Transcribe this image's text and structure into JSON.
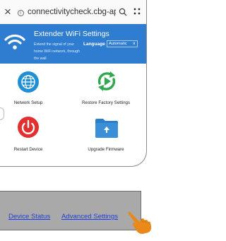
{
  "browser": {
    "close_glyph": "×",
    "url": "connectivitycheck.cbg-ap...",
    "icons": [
      "close-icon",
      "info-icon",
      "search-icon",
      "menu-dots-icon"
    ]
  },
  "header": {
    "title": "Extender WiFi Settings",
    "subtitle": "Extend the signal of your home WiFi network, through the wall",
    "language_label": "Language",
    "language_value": "Automatic",
    "logo_icon": "wifi-icon",
    "color": "#2f7dd1"
  },
  "tiles": [
    {
      "label": "Network Setup",
      "icon": "globe-icon",
      "color": "#1f8fd6"
    },
    {
      "label": "Restore Factory Settings",
      "icon": "restore-arrows-icon",
      "color": "#2fa84f"
    },
    {
      "label": "Restart Device",
      "icon": "power-icon",
      "color": "#e23030"
    },
    {
      "label": "Upgrade Firmware",
      "icon": "folder-upload-icon",
      "color": "#2a7fc8"
    }
  ],
  "footer": {
    "device_status": "Device Status",
    "advanced_settings": "Advanced Settings",
    "pointer_icon": "hand-pointer-icon"
  }
}
